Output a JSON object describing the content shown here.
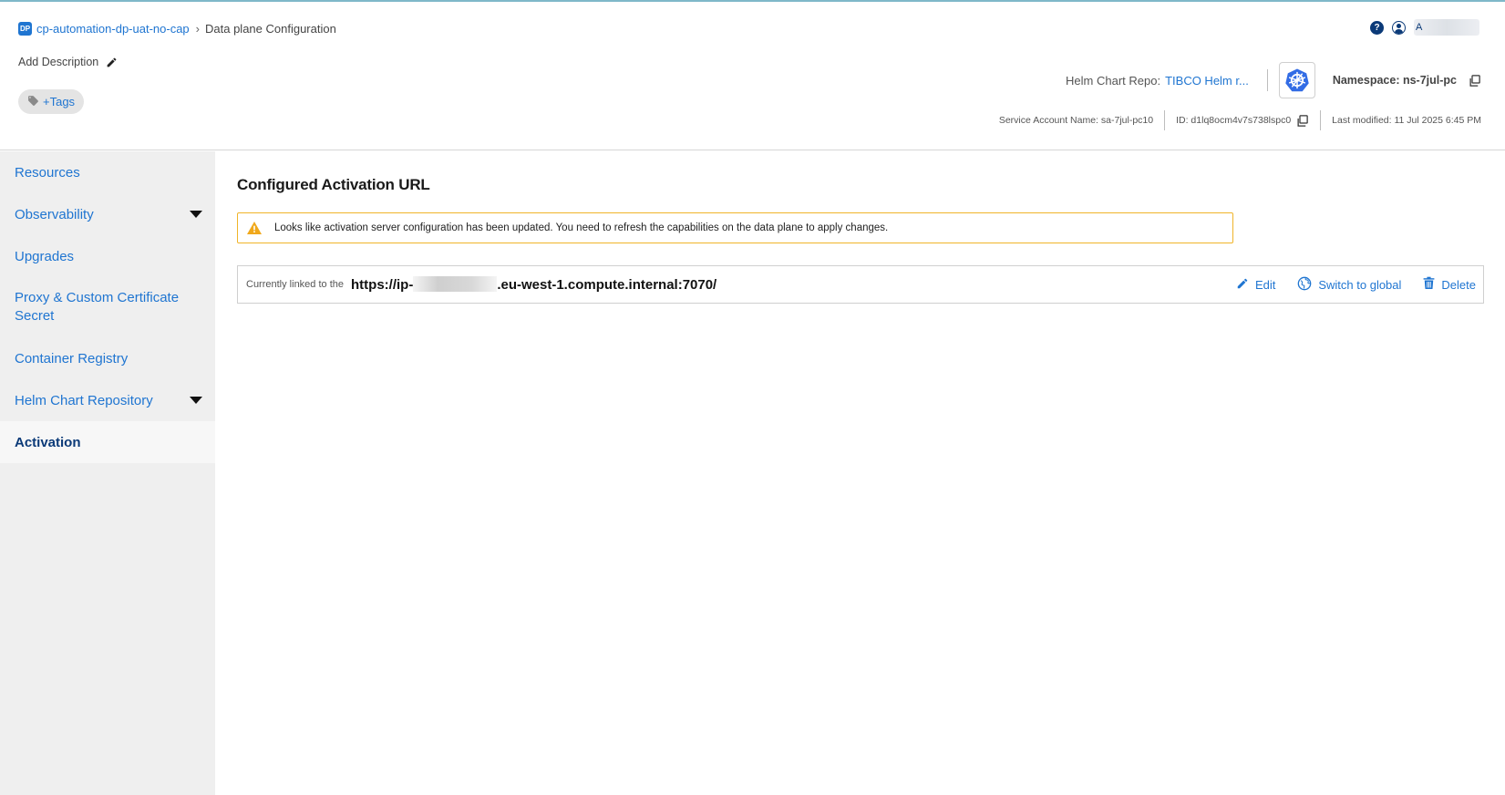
{
  "breadcrumb": {
    "badge": "DP",
    "parent": "cp-automation-dp-uat-no-cap",
    "current": "Data plane Configuration"
  },
  "header": {
    "add_description": "Add Description",
    "tags_label": "+Tags",
    "user_name": "A",
    "helm_label": "Helm Chart Repo:",
    "helm_value": "TIBCO Helm r...",
    "namespace": "Namespace: ns-7jul-pc",
    "service_account": "Service Account Name: sa-7jul-pc10",
    "id": "ID: d1lq8ocm4v7s738lspc0",
    "last_modified": "Last modified: 11 Jul 2025 6:45 PM"
  },
  "sidebar": {
    "items": [
      {
        "label": "Resources"
      },
      {
        "label": "Observability"
      },
      {
        "label": "Upgrades"
      },
      {
        "label": "Proxy & Custom Certificate Secret"
      },
      {
        "label": "Container Registry"
      },
      {
        "label": "Helm Chart Repository"
      },
      {
        "label": "Activation"
      }
    ]
  },
  "main": {
    "title": "Configured Activation URL",
    "warning": "Looks like activation server configuration has been updated. You need to refresh the capabilities on the data plane to apply changes.",
    "linked_label": "Currently linked to the",
    "url_prefix": "https://ip-",
    "url_suffix": ".eu-west-1.compute.internal:7070/",
    "actions": {
      "edit": "Edit",
      "switch": "Switch to global",
      "delete": "Delete"
    }
  },
  "colors": {
    "link": "#1f75d1",
    "active_nav": "#0b3a78",
    "warning_border": "#f0b429",
    "sidebar_bg": "#efefef"
  },
  "icons": [
    "help-icon",
    "user-icon",
    "pencil-icon",
    "tag-icon",
    "kubernetes-icon",
    "copy-icon",
    "warning-icon",
    "edit-icon",
    "globe-icon",
    "trash-icon",
    "chevron-down-icon"
  ]
}
